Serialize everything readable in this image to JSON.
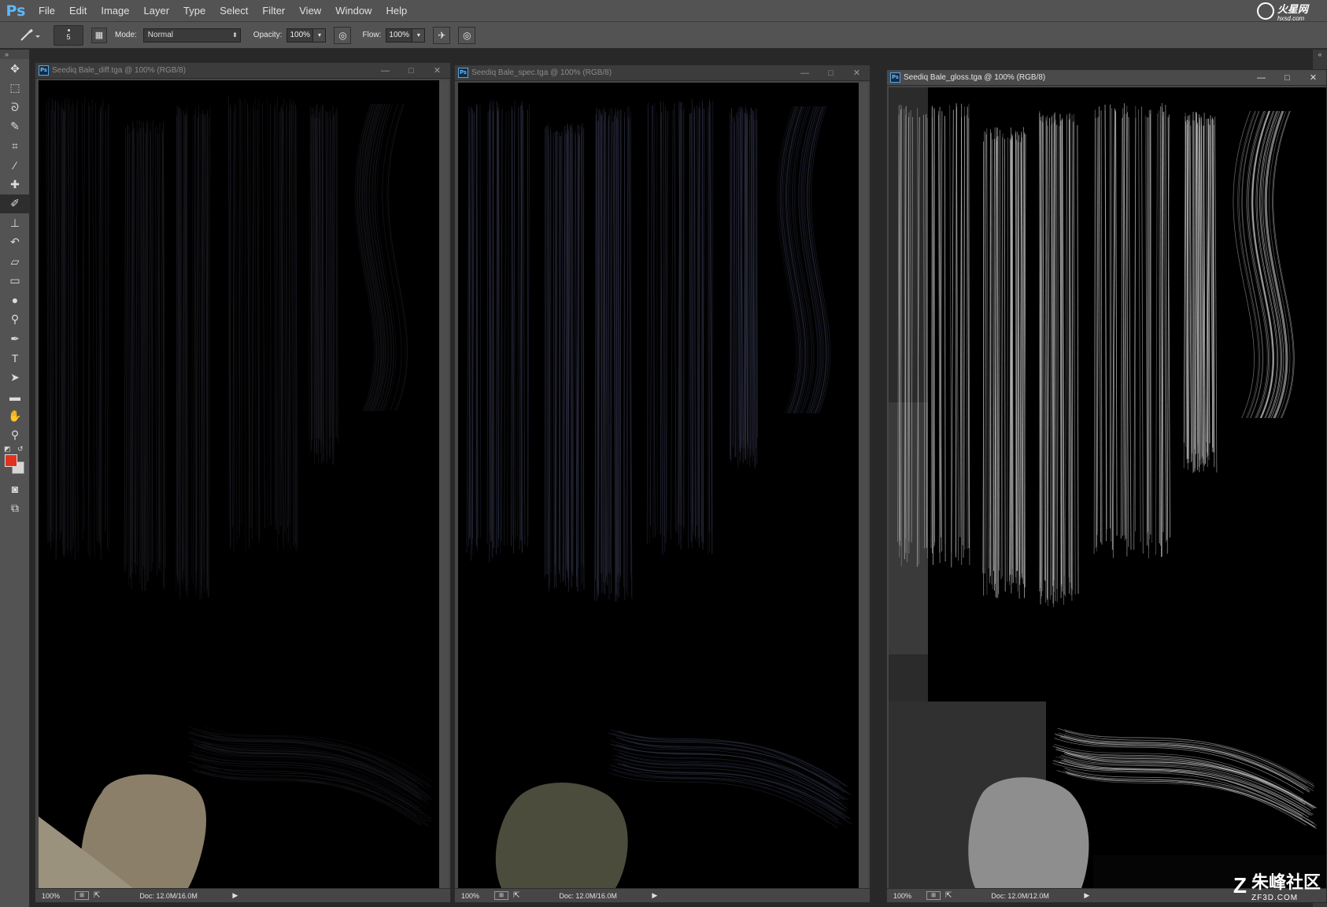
{
  "app": {
    "logo": "Ps"
  },
  "menu": [
    "File",
    "Edit",
    "Image",
    "Layer",
    "Type",
    "Select",
    "Filter",
    "View",
    "Window",
    "Help"
  ],
  "options": {
    "brush_size": "5",
    "mode_label": "Mode:",
    "mode_value": "Normal",
    "opacity_label": "Opacity:",
    "opacity_value": "100%",
    "flow_label": "Flow:",
    "flow_value": "100%"
  },
  "tools": [
    {
      "name": "move-tool",
      "icon": "✥"
    },
    {
      "name": "marquee-tool",
      "icon": "⬚"
    },
    {
      "name": "lasso-tool",
      "icon": "ᘐ"
    },
    {
      "name": "quick-selection-tool",
      "icon": "✎"
    },
    {
      "name": "crop-tool",
      "icon": "⌗"
    },
    {
      "name": "eyedropper-tool",
      "icon": "⁄"
    },
    {
      "name": "healing-brush-tool",
      "icon": "✚"
    },
    {
      "name": "brush-tool",
      "icon": "✐"
    },
    {
      "name": "clone-stamp-tool",
      "icon": "⊥"
    },
    {
      "name": "history-brush-tool",
      "icon": "↶"
    },
    {
      "name": "eraser-tool",
      "icon": "▱"
    },
    {
      "name": "gradient-tool",
      "icon": "▭"
    },
    {
      "name": "blur-tool",
      "icon": "●"
    },
    {
      "name": "dodge-tool",
      "icon": "⚲"
    },
    {
      "name": "pen-tool",
      "icon": "✒"
    },
    {
      "name": "type-tool",
      "icon": "T"
    },
    {
      "name": "path-selection-tool",
      "icon": "➤"
    },
    {
      "name": "rectangle-tool",
      "icon": "▬"
    },
    {
      "name": "hand-tool",
      "icon": "✋"
    },
    {
      "name": "zoom-tool",
      "icon": "⚲"
    }
  ],
  "colors": {
    "foreground": "#e0331e",
    "background": "#d6d6d6"
  },
  "documents": [
    {
      "title": "Seediq Bale_diff.tga @ 100% (RGB/8)",
      "zoom": "100%",
      "doc_info": "Doc: 12.0M/16.0M",
      "active": false
    },
    {
      "title": "Seediq Bale_spec.tga @ 100% (RGB/8)",
      "zoom": "100%",
      "doc_info": "Doc: 12.0M/16.0M",
      "active": false
    },
    {
      "title": "Seediq Bale_gloss.tga @ 100% (RGB/8)",
      "zoom": "100%",
      "doc_info": "Doc: 12.0M/12.0M",
      "active": true
    }
  ],
  "window_controls": {
    "minimize": "—",
    "maximize": "□",
    "close": "✕"
  },
  "watermarks": {
    "top": "火星网",
    "top_sub": "hxsd.com",
    "bottom": "朱峰社区",
    "bottom_sub": "ZF3D.COM"
  }
}
